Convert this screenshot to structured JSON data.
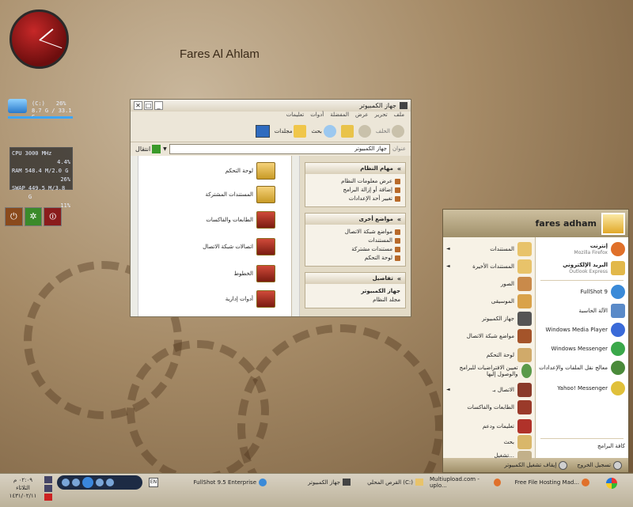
{
  "desktop": {
    "label": "Fares Al Ahlam"
  },
  "widgets": {
    "drive": {
      "name": "(C:)",
      "percent": "26%",
      "size": "8.7 G / 33.1 G"
    },
    "system": {
      "rows": [
        {
          "label": "CPU",
          "value": "3000 MHz",
          "extra": "4.4%"
        },
        {
          "label": "RAM",
          "value": "548.4 M/2.0 G",
          "extra": "26%"
        },
        {
          "label": "SWAP",
          "value": "449.5 M/3.8 G",
          "extra": "11%"
        }
      ]
    },
    "power": {
      "buttons": [
        "⏻",
        "✲",
        "⏼"
      ]
    }
  },
  "explorer": {
    "title": "جهاز الكمبيوتر",
    "menu": [
      "ملف",
      "تحرير",
      "عرض",
      "المفضلة",
      "أدوات",
      "تعليمات"
    ],
    "toolbar": {
      "back": "الخلف",
      "search": "بحث",
      "folders": "مجلدات"
    },
    "address_label": "عنوان",
    "address_value": "جهاز الكمبيوتر",
    "go": "انتقال",
    "files": [
      {
        "label": "لوحة التحكم"
      },
      {
        "label": "المستندات المشتركة"
      },
      {
        "label": "الطابعات والفاكسات"
      },
      {
        "label": "اتصالات شبكة الاتصال"
      },
      {
        "label": "الخطوط"
      },
      {
        "label": "أدوات إدارية"
      }
    ],
    "panels": [
      {
        "title": "مهام النظام",
        "items": [
          "عرض معلومات النظام",
          "إضافة أو إزالة البرامج",
          "تغيير أحد الإعدادات"
        ]
      },
      {
        "title": "مواضع أخرى",
        "items": [
          "مواضع شبكة الاتصال",
          "المستندات",
          "مستندات مشتركة",
          "لوحة التحكم"
        ]
      },
      {
        "title": "تفاصيل",
        "items": [
          "جهاز الكمبيوتر",
          "مجلد النظام"
        ]
      }
    ]
  },
  "start_menu": {
    "user": "fares adham",
    "pinned": [
      {
        "title": "إنترنت",
        "sub": "Mozilla Firefox"
      },
      {
        "title": "البريد الإلكتروني",
        "sub": "Outlook Express"
      }
    ],
    "recent": [
      "FullShot 9",
      "الآلة الحاسبة",
      "Windows Media Player",
      "Windows Messenger",
      "معالج نقل الملفات والإعدادات",
      "Yahoo! Messenger"
    ],
    "all_programs": "كافة البرامج",
    "places": [
      "المستندات",
      "المستندات الأخيرة",
      "الصور",
      "الموسيقى",
      "جهاز الكمبيوتر",
      "مواضع شبكة الاتصال",
      "لوحة التحكم",
      "تعيين الافتراضيات للبرامج والوصول إليها",
      "الاتصال بـ",
      "الطابعات والفاكسات",
      "تعليمات ودعم",
      "بحث",
      "تشغيل..."
    ],
    "logoff": "تسجيل الخروج",
    "shutdown": "إيقاف تشغيل الكمبيوتر"
  },
  "taskbar": {
    "time": "٠٢:٠٩ م",
    "day": "الثلاثاء",
    "date": "١٤٣١/٠٢/١١",
    "lang": "EN",
    "tasks": [
      "FullShot 9.5 Enterprise",
      "جهاز الكمبيوتر",
      "القرص المحلي (C:)",
      "Multiupload.com - uplo...",
      "Free File Hosting Mad..."
    ]
  }
}
